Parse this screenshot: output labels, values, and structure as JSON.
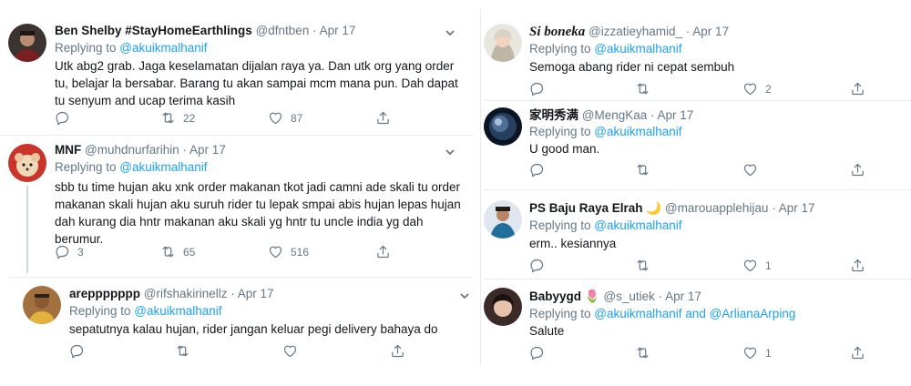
{
  "left": {
    "tweets": [
      {
        "name": "Ben Shelby #StayHomeEarthlings",
        "handle": "@dfntben",
        "sep": " · ",
        "date": "Apr 17",
        "reply_prefix": "Replying to ",
        "reply_to": "@akuikmalhanif",
        "text": "Utk abg2 grab. Jaga keselamatan dijalan raya ya. Dan utk org yang order tu, belajar la bersabar. Barang tu akan sampai mcm mana pun. Dah dapat tu senyum and ucap terima kasih",
        "replies": "",
        "retweets": "22",
        "likes": "87"
      },
      {
        "name": "MNF",
        "handle": "@muhdnurfarihin",
        "sep": " · ",
        "date": "Apr 17",
        "reply_prefix": "Replying to ",
        "reply_to": "@akuikmalhanif",
        "text": "sbb tu time hujan aku xnk order makanan tkot jadi camni ade skali tu order makanan skali hujan aku suruh rider tu lepak smpai abis hujan lepas hujan dah kurang dia hntr makanan aku skali yg hntr tu uncle india yg dah berumur.",
        "replies": "3",
        "retweets": "65",
        "likes": "516"
      },
      {
        "name": "areppppppp",
        "handle": "@rifshakirinellz",
        "sep": " · ",
        "date": "Apr 17",
        "reply_prefix": "Replying to ",
        "reply_to": "@akuikmalhanif",
        "text": "sepatutnya kalau hujan, rider jangan keluar pegi delivery bahaya do",
        "replies": "",
        "retweets": "",
        "likes": ""
      }
    ]
  },
  "right": {
    "tweets": [
      {
        "name": "Si boneka",
        "handle": "@izzatieyhamid_",
        "sep": " · ",
        "date": "Apr 17",
        "reply_prefix": "Replying to ",
        "reply_to": "@akuikmalhanif",
        "text": "Semoga abang rider ni cepat sembuh",
        "replies": "",
        "retweets": "",
        "likes": "2"
      },
      {
        "name": "家明秀满",
        "handle": "@MengKaa",
        "sep": " · ",
        "date": "Apr 17",
        "reply_prefix": "Replying to ",
        "reply_to": "@akuikmalhanif",
        "text": "U good man.",
        "replies": "",
        "retweets": "",
        "likes": ""
      },
      {
        "name": "PS Baju Raya Elrah",
        "name_emoji": "🌙",
        "handle": "@marouapplehijau",
        "sep": " · ",
        "date": "Apr 17",
        "reply_prefix": "Replying to ",
        "reply_to": "@akuikmalhanif",
        "text": "erm.. kesiannya",
        "replies": "",
        "retweets": "",
        "likes": "1"
      },
      {
        "name": "Babyygd",
        "name_emoji": "🌷",
        "handle": "@s_utiek",
        "sep": " · ",
        "date": "Apr 17",
        "reply_prefix": "Replying to ",
        "reply_to": "@akuikmalhanif",
        "reply_and": " and ",
        "reply_to2": "@ArlianaArping",
        "text": "Salute",
        "replies": "",
        "retweets": "",
        "likes": "1"
      }
    ]
  },
  "icons": {
    "reply": "reply-icon",
    "retweet": "retweet-icon",
    "like": "heart-icon",
    "share": "share-icon",
    "more": "chevron-down-icon"
  },
  "colors": {
    "link": "#1da1f2",
    "muted": "#657786",
    "text": "#14171a",
    "divider": "#e6ecf0"
  }
}
